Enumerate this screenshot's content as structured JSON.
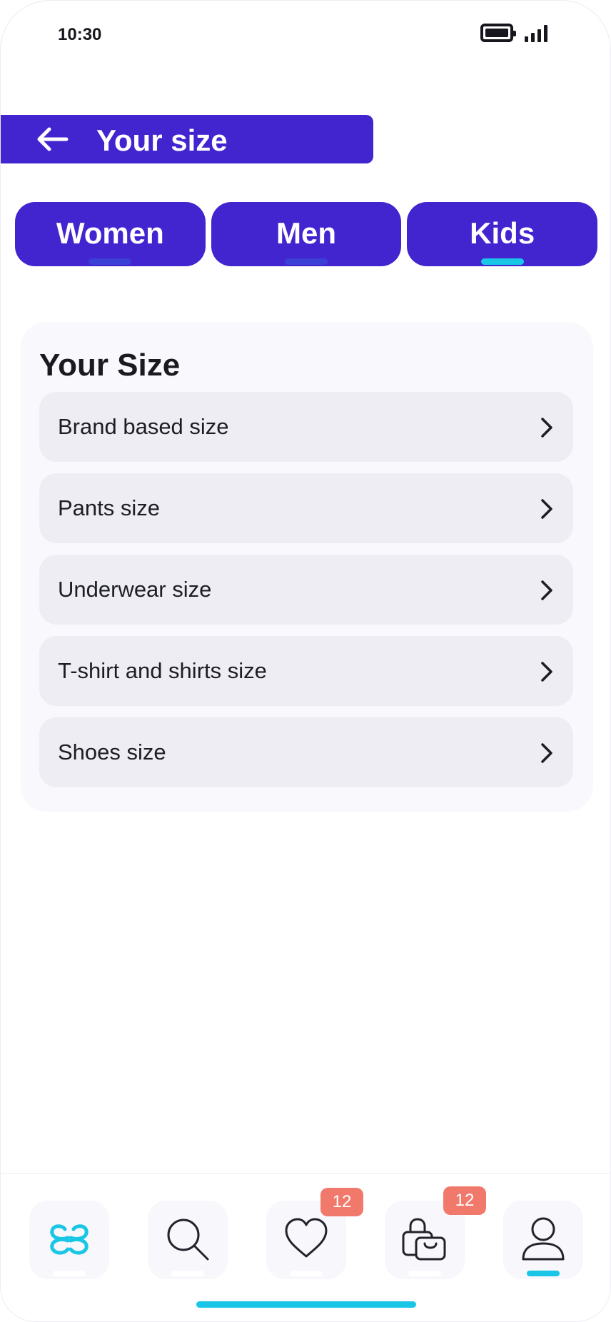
{
  "status_bar": {
    "time": "10:30"
  },
  "header": {
    "title": "Your size"
  },
  "tabs": [
    {
      "label": "Women",
      "active": false
    },
    {
      "label": "Men",
      "active": false
    },
    {
      "label": "Kids",
      "active": true
    }
  ],
  "card": {
    "title": "Your Size",
    "items": [
      {
        "label": "Brand based size"
      },
      {
        "label": "Pants size"
      },
      {
        "label": "Underwear size"
      },
      {
        "label": "T-shirt and shirts size"
      },
      {
        "label": "Shoes size"
      }
    ]
  },
  "bottom_nav": {
    "items": [
      {
        "name": "home",
        "icon": "logo-icon",
        "active": false
      },
      {
        "name": "search",
        "icon": "search-icon",
        "active": false
      },
      {
        "name": "favorites",
        "icon": "heart-icon",
        "active": false,
        "badge": "12"
      },
      {
        "name": "bag",
        "icon": "shopping-bag-icon",
        "active": false,
        "badge": "12"
      },
      {
        "name": "profile",
        "icon": "user-icon",
        "active": true
      }
    ]
  },
  "colors": {
    "primary": "#4325d0",
    "accent": "#19c6e6",
    "badge": "#f1796b",
    "card_bg": "#f8f8fd",
    "item_bg": "#ededf3"
  }
}
